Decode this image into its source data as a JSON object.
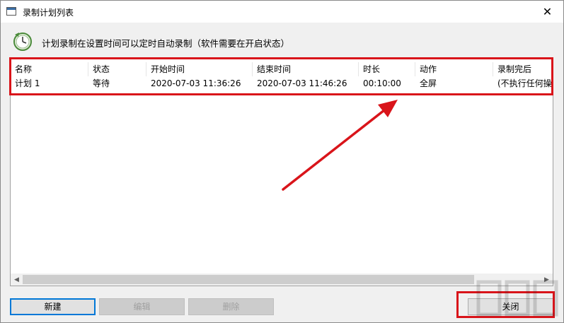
{
  "window": {
    "title": "录制计划列表",
    "close_glyph": "✕"
  },
  "info": {
    "text": "计划录制在设置时间可以定时自动录制（软件需要在开启状态）"
  },
  "table": {
    "headers": [
      "名称",
      "状态",
      "开始时间",
      "结束时间",
      "时长",
      "动作",
      "录制完后"
    ],
    "rows": [
      [
        "计划 1",
        "等待",
        "2020-07-03 11:36:26",
        "2020-07-03 11:46:26",
        "00:10:00",
        "全屏",
        "(不执行任何操"
      ]
    ]
  },
  "buttons": {
    "new": "新建",
    "edit": "编辑",
    "delete": "删除",
    "close": "关闭"
  },
  "scrollbar": {
    "left_glyph": "◀",
    "right_glyph": "▶"
  },
  "colors": {
    "highlight_red": "#d9141a",
    "accent_blue": "#0078d7"
  }
}
